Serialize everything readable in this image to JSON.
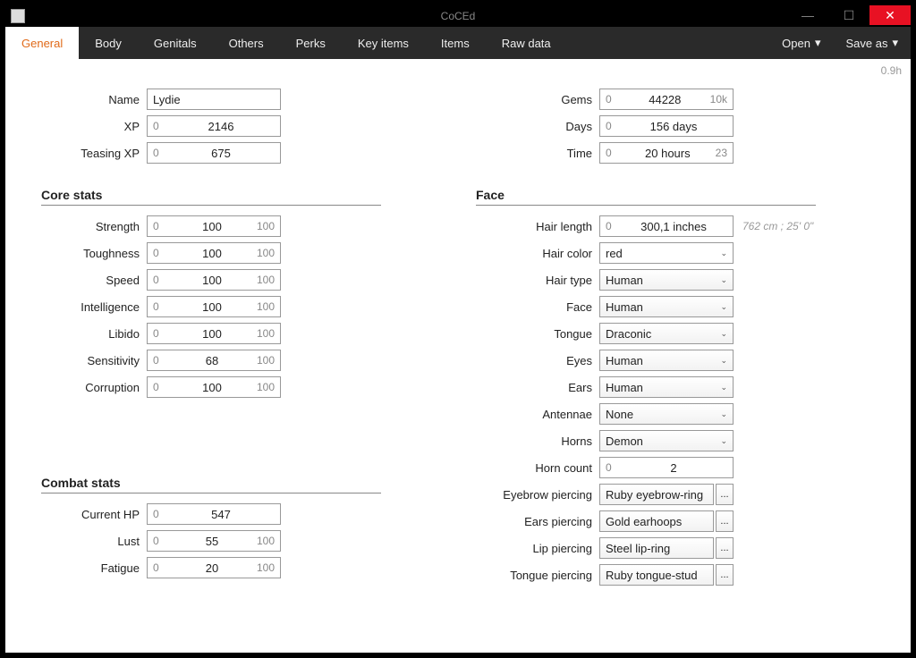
{
  "window": {
    "title": "CoCEd"
  },
  "menus": {
    "open": "Open",
    "saveas": "Save as"
  },
  "version": "0.9h",
  "tabs": [
    "General",
    "Body",
    "Genitals",
    "Others",
    "Perks",
    "Key items",
    "Items",
    "Raw data"
  ],
  "left": {
    "basic": {
      "name_label": "Name",
      "name": "Lydie",
      "xp_label": "XP",
      "xp_prefix": "0",
      "xp": "2146",
      "txp_label": "Teasing XP",
      "txp_prefix": "0",
      "txp": "675"
    },
    "core_title": "Core stats",
    "core": [
      {
        "label": "Strength",
        "pre": "0",
        "val": "100",
        "suf": "100"
      },
      {
        "label": "Toughness",
        "pre": "0",
        "val": "100",
        "suf": "100"
      },
      {
        "label": "Speed",
        "pre": "0",
        "val": "100",
        "suf": "100"
      },
      {
        "label": "Intelligence",
        "pre": "0",
        "val": "100",
        "suf": "100"
      },
      {
        "label": "Libido",
        "pre": "0",
        "val": "100",
        "suf": "100"
      },
      {
        "label": "Sensitivity",
        "pre": "0",
        "val": "68",
        "suf": "100"
      },
      {
        "label": "Corruption",
        "pre": "0",
        "val": "100",
        "suf": "100"
      }
    ],
    "combat_title": "Combat stats",
    "combat": [
      {
        "label": "Current HP",
        "pre": "0",
        "val": "547",
        "suf": ""
      },
      {
        "label": "Lust",
        "pre": "0",
        "val": "55",
        "suf": "100"
      },
      {
        "label": "Fatigue",
        "pre": "0",
        "val": "20",
        "suf": "100"
      }
    ]
  },
  "right": {
    "basic": {
      "gems_label": "Gems",
      "gems_pre": "0",
      "gems": "44228",
      "gems_suf": "10k",
      "days_label": "Days",
      "days_pre": "0",
      "days": "156 days",
      "time_label": "Time",
      "time_pre": "0",
      "time": "20 hours",
      "time_suf": "23"
    },
    "face_title": "Face",
    "hairlen": {
      "label": "Hair length",
      "pre": "0",
      "val": "300,1 inches",
      "hint": "762 cm ; 25' 0\""
    },
    "haircolor": {
      "label": "Hair color",
      "val": "red"
    },
    "selects": [
      {
        "label": "Hair type",
        "val": "Human"
      },
      {
        "label": "Face",
        "val": "Human"
      },
      {
        "label": "Tongue",
        "val": "Draconic"
      },
      {
        "label": "Eyes",
        "val": "Human"
      },
      {
        "label": "Ears",
        "val": "Human"
      },
      {
        "label": "Antennae",
        "val": "None"
      },
      {
        "label": "Horns",
        "val": "Demon"
      }
    ],
    "horncount": {
      "label": "Horn count",
      "pre": "0",
      "val": "2"
    },
    "piercings": [
      {
        "label": "Eyebrow piercing",
        "val": "Ruby eyebrow-ring"
      },
      {
        "label": "Ears piercing",
        "val": "Gold earhoops"
      },
      {
        "label": "Lip piercing",
        "val": "Steel lip-ring"
      },
      {
        "label": "Tongue piercing",
        "val": "Ruby tongue-stud"
      }
    ],
    "ellipsis": "..."
  }
}
